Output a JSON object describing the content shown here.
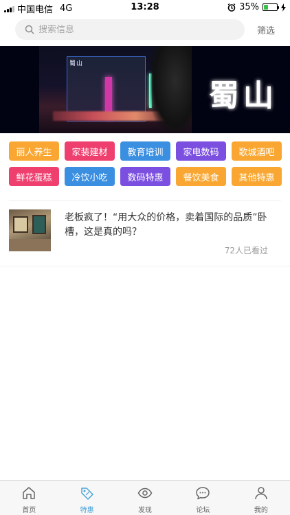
{
  "status_bar": {
    "carrier": "中国电信",
    "network": "4G",
    "time": "13:28",
    "battery_percent": "35%",
    "battery_level": 0.35
  },
  "search": {
    "placeholder": "搜索信息",
    "filter_label": "筛选"
  },
  "banner": {
    "title": "蜀山",
    "sign_text": "蜀山"
  },
  "categories": [
    {
      "label": "丽人养生",
      "color": "#f9a732"
    },
    {
      "label": "家装建材",
      "color": "#ee3f6e"
    },
    {
      "label": "教育培训",
      "color": "#3b8fe0"
    },
    {
      "label": "家电数码",
      "color": "#7b4fe0"
    },
    {
      "label": "歌城酒吧",
      "color": "#f9a732"
    },
    {
      "label": "鲜花蛋糕",
      "color": "#ee3f6e"
    },
    {
      "label": "冷饮小吃",
      "color": "#3b8fe0"
    },
    {
      "label": "数码特惠",
      "color": "#7b4fe0"
    },
    {
      "label": "餐饮美食",
      "color": "#f9a732"
    },
    {
      "label": "其他特惠",
      "color": "#f9a732"
    }
  ],
  "articles": [
    {
      "title": "老板疯了！“用大众的价格，卖着国际的品质”卧槽，这是真的吗？",
      "views": "72人已看过"
    }
  ],
  "tabbar": {
    "items": [
      {
        "label": "首页",
        "icon": "home-icon"
      },
      {
        "label": "特惠",
        "icon": "tag-icon",
        "active": true
      },
      {
        "label": "发现",
        "icon": "eye-icon"
      },
      {
        "label": "论坛",
        "icon": "chat-icon"
      },
      {
        "label": "我的",
        "icon": "user-icon"
      }
    ],
    "active_color": "#4aa3d8"
  }
}
